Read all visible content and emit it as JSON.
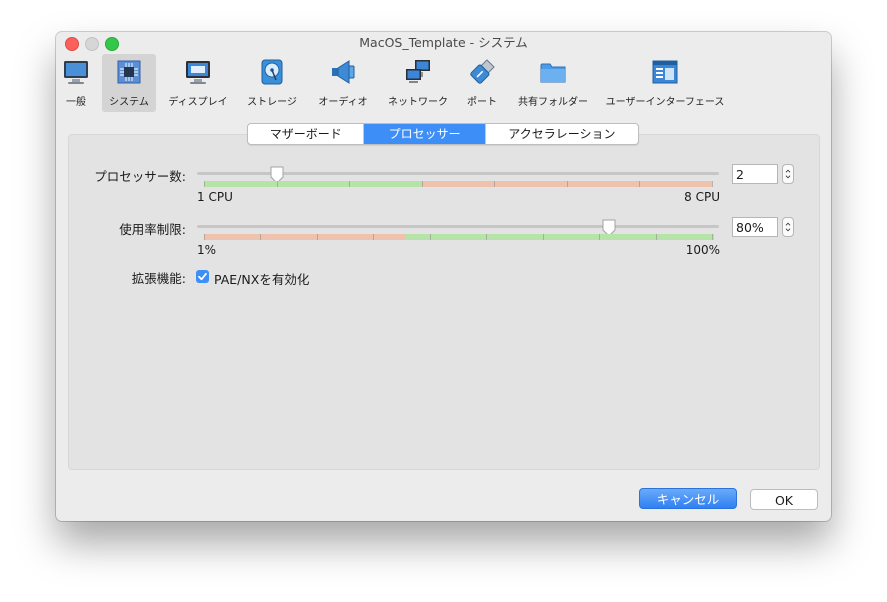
{
  "window": {
    "title": "MacOS_Template - システム"
  },
  "toolbar": {
    "items": [
      {
        "label": "一般",
        "icon": "monitor-general-icon"
      },
      {
        "label": "システム",
        "icon": "chip-icon"
      },
      {
        "label": "ディスプレイ",
        "icon": "display-icon"
      },
      {
        "label": "ストレージ",
        "icon": "hard-disk-icon"
      },
      {
        "label": "オーディオ",
        "icon": "speaker-icon"
      },
      {
        "label": "ネットワーク",
        "icon": "network-icon"
      },
      {
        "label": "ポート",
        "icon": "usb-plug-icon"
      },
      {
        "label": "共有フォルダー",
        "icon": "folder-icon"
      },
      {
        "label": "ユーザーインターフェース",
        "icon": "ui-window-icon"
      }
    ],
    "active_index": 1
  },
  "tabs": {
    "items": [
      "マザーボード",
      "プロセッサー",
      "アクセラレーション"
    ],
    "active": "プロセッサー"
  },
  "processor": {
    "cpu_count_label": "プロセッサー数:",
    "cpu_value": "2",
    "cpu_current": 2,
    "cpu_min_label": "1 CPU",
    "cpu_max_label": "8 CPU",
    "cpu_min": 1,
    "cpu_max": 8,
    "cap_label": "使用率制限:",
    "cap_value": "80%",
    "cap_current": 80,
    "cap_min_label": "1%",
    "cap_max_label": "100%",
    "features_label": "拡張機能:",
    "pae_label": "PAE/NXを有効化",
    "pae_checked": true
  },
  "buttons": {
    "cancel": "キャンセル",
    "ok": "OK"
  },
  "colors": {
    "accent": "#3e8ef7",
    "safe_zone": "#b5e3a8",
    "warn_zone": "#eec2ad"
  }
}
